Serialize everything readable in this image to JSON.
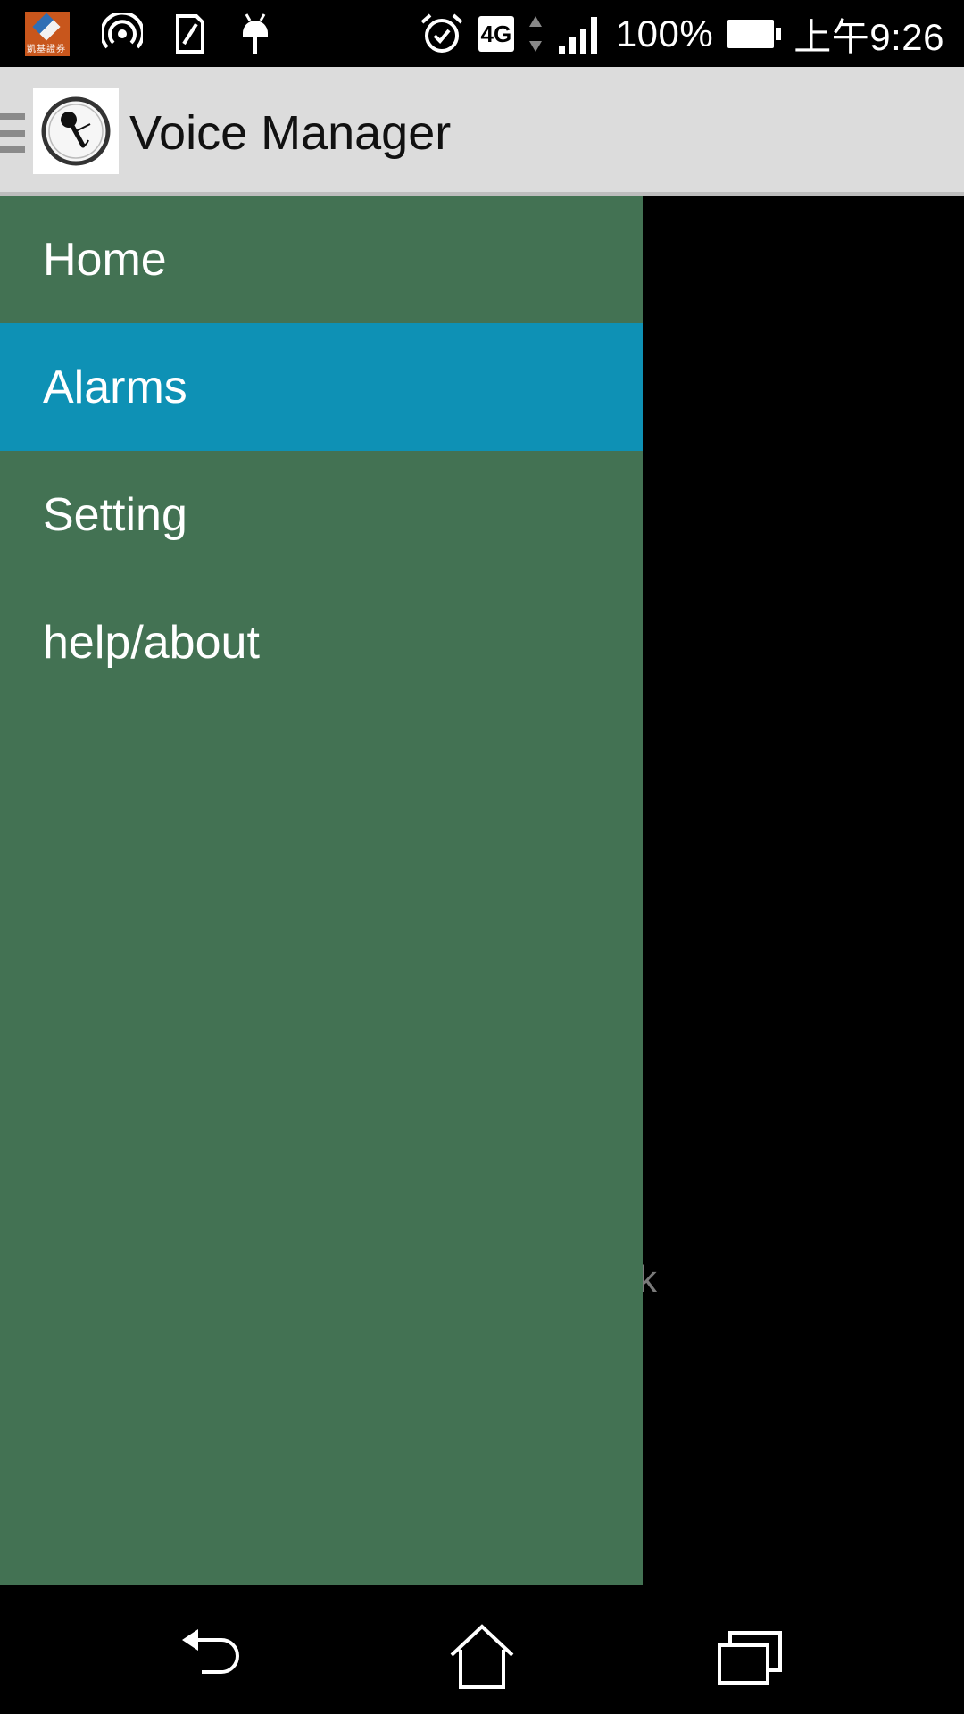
{
  "status_bar": {
    "notification_app_text": "凱基證券",
    "left_icons": [
      "app-notification-icon",
      "hotspot-icon",
      "sim-card-icon",
      "android-debug-icon"
    ],
    "right_icons": [
      "alarm-clock-icon",
      "network-4g-icon",
      "signal-strength-icon",
      "battery-icon"
    ],
    "network_type": "4G",
    "battery_percent": "100%",
    "time": "上午9:26"
  },
  "action_bar": {
    "menu_icon": "drawer-indicator-icon",
    "logo_icon": "microphone-clock-logo-icon",
    "title": "Voice Manager"
  },
  "drawer": {
    "items": [
      {
        "label": "Home",
        "selected": false
      },
      {
        "label": "Alarms",
        "selected": true
      },
      {
        "label": "Setting",
        "selected": false
      },
      {
        "label": "help/about",
        "selected": false
      }
    ],
    "selected_color": "#0e91b5",
    "background_color": "#437253"
  },
  "content": {
    "peek_text": "k"
  },
  "nav_bar": {
    "icons": [
      "back-icon",
      "home-icon",
      "recent-apps-icon"
    ]
  }
}
